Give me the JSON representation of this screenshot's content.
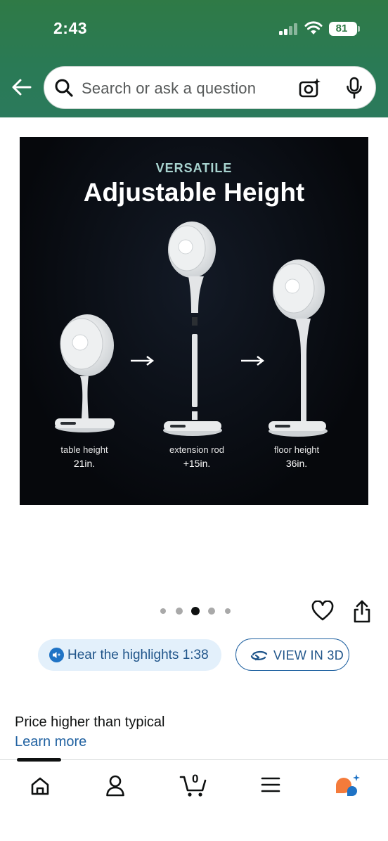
{
  "status_bar": {
    "time": "2:43",
    "battery_level": "81",
    "signal_bars_filled": 2,
    "signal_bars_total": 4
  },
  "header": {
    "background_color": "#2f7a46",
    "back_icon": "back-arrow-icon",
    "search": {
      "placeholder": "Search or ask a question",
      "icons": [
        "search-icon",
        "camera-sparkle-icon",
        "microphone-icon"
      ]
    }
  },
  "product_image": {
    "eyebrow": "VERSATILE",
    "headline": "Adjustable Height",
    "stages": [
      {
        "label": "table height",
        "value": "21in."
      },
      {
        "label": "extension rod",
        "value": "+15in."
      },
      {
        "label": "floor height",
        "value": "36in."
      }
    ]
  },
  "carousel": {
    "total_dots": 5,
    "active_index": 2
  },
  "actions": {
    "wishlist_icon": "heart-icon",
    "share_icon": "share-icon"
  },
  "audio_summary": {
    "label": "Hear the highlights 1:38",
    "icon": "speaker-sparkle-icon"
  },
  "view_3d": {
    "label": "VIEW IN 3D",
    "icon": "rotate-3d-icon"
  },
  "price_notice": {
    "text": "Price higher than typical",
    "link": "Learn more"
  },
  "bottom_nav": {
    "items": [
      "home-icon",
      "account-icon",
      "cart-icon",
      "menu-icon",
      "rufus-assistant-icon"
    ],
    "cart_count": "0",
    "active_index": 0
  },
  "colors": {
    "link_blue": "#2162a1",
    "pill_bg": "#e3f0fb",
    "assistant_orange": "#f47b3b",
    "assistant_blue": "#1f73c5"
  }
}
